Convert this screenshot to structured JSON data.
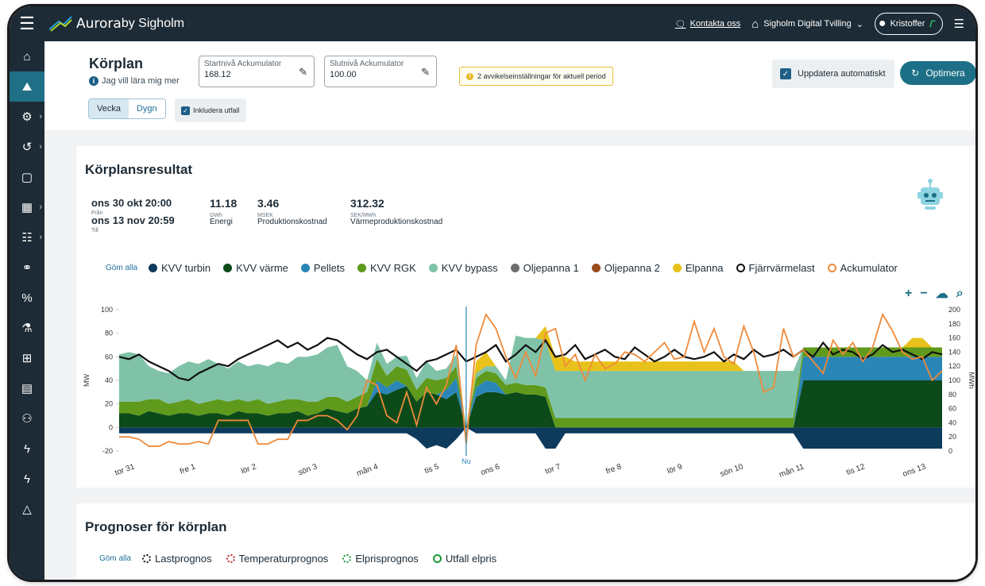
{
  "topbar": {
    "brand": "Aurora",
    "brand_by": "by Sigholm",
    "contact": "Kontakta oss",
    "plant": "Sigholm Digital Tvilling",
    "user": "Kristoffer"
  },
  "sidebar": {
    "items": [
      {
        "icon": "home-icon",
        "glyph": "⌂",
        "chevron": false,
        "active": false
      },
      {
        "icon": "chart-icon",
        "glyph": "⛰",
        "chevron": false,
        "active": true
      },
      {
        "icon": "gears-icon",
        "glyph": "⚙",
        "chevron": true,
        "active": false
      },
      {
        "icon": "history-icon",
        "glyph": "↺",
        "chevron": true,
        "active": false
      },
      {
        "icon": "note-icon",
        "glyph": "▢",
        "chevron": false,
        "active": false
      },
      {
        "icon": "calendar-icon",
        "glyph": "▦",
        "chevron": true,
        "active": false
      },
      {
        "icon": "contact-card-icon",
        "glyph": "☷",
        "chevron": true,
        "active": false
      },
      {
        "icon": "handshake-icon",
        "glyph": "⚭",
        "chevron": false,
        "active": false
      },
      {
        "icon": "percent-icon",
        "glyph": "%",
        "chevron": false,
        "active": false
      },
      {
        "icon": "flask-icon",
        "glyph": "⚗",
        "chevron": false,
        "active": false
      },
      {
        "icon": "grid-icon",
        "glyph": "⊞",
        "chevron": false,
        "active": false
      },
      {
        "icon": "document-icon",
        "glyph": "▤",
        "chevron": false,
        "active": false
      },
      {
        "icon": "users-icon",
        "glyph": "⚇",
        "chevron": false,
        "active": false
      },
      {
        "icon": "bolt-icon",
        "glyph": "ϟ",
        "chevron": false,
        "active": false
      },
      {
        "icon": "bolt-icon-2",
        "glyph": "ϟ",
        "chevron": false,
        "active": false
      },
      {
        "icon": "mountain-icon",
        "glyph": "△",
        "chevron": false,
        "active": false
      }
    ]
  },
  "header": {
    "title": "Körplan",
    "learn": "Jag vill lära mig mer",
    "start_label": "Startnivå Ackumulator",
    "start_value": "168.12",
    "end_label": "Slutnivå Ackumulator",
    "end_value": "100.00",
    "warning": "2 avvikelseinställningar för aktuell period",
    "auto_update": "Uppdatera automatiskt",
    "optimize": "Optimera",
    "seg_week": "Vecka",
    "seg_day": "Dygn",
    "include": "Inkludera utfall"
  },
  "result": {
    "title": "Körplansresultat",
    "from_date": "ons 30 okt 20:00",
    "from_label": "Från",
    "to_date": "ons 13 nov 20:59",
    "to_label": "Till",
    "metrics": [
      {
        "value": "11.18",
        "unit": "GWh",
        "label": "Energi"
      },
      {
        "value": "3.46",
        "unit": "MSEK",
        "label": "Produktionskostnad"
      },
      {
        "value": "312.32",
        "unit": "SEK/MWh",
        "label": "Värmeproduktionskostnad"
      }
    ],
    "hide_all": "Göm alla",
    "legend": [
      {
        "name": "KVV turbin",
        "color": "#0e3a5c",
        "style": "dot"
      },
      {
        "name": "KVV värme",
        "color": "#0c4a1a",
        "style": "dot"
      },
      {
        "name": "Pellets",
        "color": "#2b86b8",
        "style": "dot"
      },
      {
        "name": "KVV RGK",
        "color": "#5f9a1c",
        "style": "dot"
      },
      {
        "name": "KVV bypass",
        "color": "#7fc2a8",
        "style": "dot"
      },
      {
        "name": "Oljepanna 1",
        "color": "#6e6e6e",
        "style": "dot"
      },
      {
        "name": "Oljepanna 2",
        "color": "#9a4a1a",
        "style": "dot"
      },
      {
        "name": "Elpanna",
        "color": "#e8c21a",
        "style": "dot"
      },
      {
        "name": "Fjärrvärmelast",
        "color": "#111111",
        "style": "ring"
      },
      {
        "name": "Ackumulator",
        "color": "#ef8a3a",
        "style": "ring"
      }
    ]
  },
  "chart_data": {
    "type": "area",
    "ylabel": "MW",
    "y2label": "MWh",
    "ylim": [
      -20,
      100
    ],
    "y2lim": [
      0,
      200
    ],
    "yticks": [
      "100",
      "80",
      "60",
      "40",
      "20",
      "0",
      "-20"
    ],
    "y2ticks": [
      "200",
      "180",
      "160",
      "140",
      "120",
      "100",
      "80",
      "60",
      "40",
      "20",
      "0"
    ],
    "now_label": "Nu",
    "now_index": 35,
    "categories": [
      "tor 31",
      "fre 1",
      "lör 2",
      "sön 3",
      "mån 4",
      "tis 5",
      "ons 6",
      "tor 7",
      "fre 8",
      "lör 9",
      "sön 10",
      "mån 11",
      "tis 12",
      "ons 13"
    ],
    "x": [
      0,
      1,
      2,
      3,
      4,
      5,
      6,
      7,
      8,
      9,
      10,
      11,
      12,
      13,
      14,
      15,
      16,
      17,
      18,
      19,
      20,
      21,
      22,
      23,
      24,
      25,
      26,
      27,
      28,
      29,
      30,
      31,
      32,
      33,
      34,
      35,
      36,
      37,
      38,
      39,
      40,
      41,
      42,
      43,
      44,
      45,
      46,
      47,
      48,
      49,
      50,
      51,
      52,
      53,
      54,
      55,
      56,
      57,
      58,
      59,
      60,
      61,
      62,
      63,
      64,
      65,
      66,
      67,
      68,
      69,
      70,
      71,
      72,
      73,
      74,
      75,
      76,
      77,
      78,
      79,
      80,
      81,
      82,
      83
    ],
    "series": [
      {
        "name": "KVV turbin",
        "values": [
          -5,
          -5,
          -5,
          -5,
          -5,
          -5,
          -5,
          -5,
          -5,
          -5,
          -5,
          -5,
          -5,
          -5,
          -5,
          -5,
          -5,
          -5,
          -5,
          -5,
          -5,
          -5,
          -5,
          -5,
          -5,
          -5,
          -5,
          -5,
          -5,
          -5,
          -10,
          -18,
          -15,
          -18,
          -10,
          0,
          -5,
          -5,
          -5,
          -5,
          -5,
          -5,
          -5,
          -18,
          -18,
          -5,
          -5,
          -5,
          -5,
          -5,
          -5,
          -5,
          -5,
          -5,
          -5,
          -5,
          -5,
          -5,
          -5,
          -5,
          -5,
          -5,
          -5,
          -5,
          -5,
          -5,
          -5,
          -5,
          -5,
          -18,
          -18,
          -18,
          -18,
          -18,
          -18,
          -18,
          -18,
          -18,
          -18,
          -18,
          -18,
          -18,
          -18,
          -18
        ]
      },
      {
        "name": "KVV värme",
        "values": [
          12,
          12,
          10,
          14,
          12,
          10,
          12,
          12,
          10,
          12,
          12,
          10,
          14,
          12,
          12,
          10,
          12,
          12,
          14,
          10,
          12,
          16,
          14,
          12,
          16,
          18,
          30,
          28,
          32,
          35,
          22,
          30,
          28,
          24,
          30,
          0,
          26,
          30,
          30,
          28,
          30,
          28,
          28,
          26,
          0,
          0,
          0,
          0,
          0,
          0,
          0,
          0,
          0,
          0,
          0,
          0,
          0,
          0,
          0,
          0,
          0,
          0,
          0,
          0,
          0,
          0,
          0,
          0,
          0,
          40,
          40,
          40,
          40,
          40,
          40,
          40,
          40,
          40,
          40,
          40,
          40,
          40,
          40,
          40
        ]
      },
      {
        "name": "Pellets",
        "values": [
          0,
          0,
          0,
          0,
          0,
          0,
          0,
          0,
          0,
          0,
          0,
          0,
          0,
          0,
          0,
          0,
          0,
          0,
          0,
          0,
          0,
          0,
          0,
          0,
          0,
          0,
          10,
          6,
          8,
          0,
          0,
          0,
          0,
          8,
          12,
          0,
          8,
          10,
          8,
          0,
          0,
          0,
          0,
          0,
          0,
          0,
          0,
          0,
          0,
          0,
          0,
          0,
          0,
          0,
          0,
          0,
          0,
          0,
          0,
          0,
          0,
          0,
          0,
          0,
          0,
          0,
          0,
          0,
          0,
          20,
          20,
          20,
          20,
          20,
          20,
          20,
          20,
          20,
          20,
          20,
          20,
          20,
          20,
          20
        ]
      },
      {
        "name": "KVV RGK",
        "values": [
          10,
          10,
          12,
          10,
          12,
          10,
          10,
          12,
          10,
          10,
          12,
          12,
          10,
          10,
          12,
          10,
          10,
          12,
          10,
          12,
          10,
          10,
          12,
          10,
          10,
          12,
          18,
          10,
          12,
          14,
          10,
          12,
          12,
          10,
          10,
          0,
          8,
          8,
          8,
          8,
          8,
          8,
          8,
          8,
          8,
          8,
          8,
          8,
          8,
          8,
          8,
          8,
          8,
          8,
          8,
          8,
          8,
          8,
          8,
          8,
          8,
          8,
          8,
          8,
          8,
          8,
          8,
          8,
          8,
          8,
          8,
          8,
          8,
          8,
          8,
          8,
          8,
          8,
          8,
          8,
          8,
          8,
          8,
          8
        ]
      },
      {
        "name": "KVV bypass",
        "values": [
          40,
          42,
          40,
          28,
          24,
          26,
          30,
          32,
          34,
          36,
          30,
          28,
          32,
          30,
          30,
          32,
          34,
          30,
          36,
          38,
          40,
          42,
          44,
          30,
          22,
          10,
          14,
          10,
          8,
          12,
          10,
          14,
          8,
          8,
          10,
          0,
          4,
          4,
          6,
          4,
          40,
          40,
          40,
          40,
          40,
          40,
          40,
          40,
          40,
          40,
          40,
          40,
          40,
          40,
          40,
          40,
          40,
          40,
          40,
          40,
          40,
          40,
          40,
          40,
          40,
          40,
          40,
          40,
          40,
          0,
          0,
          0,
          0,
          0,
          0,
          0,
          0,
          0,
          0,
          0,
          0,
          0,
          0,
          0
        ]
      },
      {
        "name": "Elpanna",
        "values": [
          0,
          0,
          0,
          0,
          0,
          0,
          0,
          0,
          0,
          0,
          0,
          0,
          0,
          0,
          0,
          0,
          0,
          0,
          0,
          0,
          0,
          0,
          0,
          0,
          0,
          0,
          0,
          0,
          0,
          0,
          0,
          0,
          0,
          0,
          0,
          0,
          10,
          12,
          0,
          0,
          0,
          0,
          0,
          12,
          12,
          12,
          8,
          8,
          8,
          8,
          8,
          8,
          8,
          8,
          8,
          8,
          8,
          8,
          8,
          8,
          8,
          8,
          8,
          0,
          0,
          0,
          0,
          0,
          0,
          0,
          0,
          0,
          0,
          0,
          0,
          0,
          0,
          0,
          0,
          0,
          8,
          8,
          0,
          0
        ]
      },
      {
        "name": "Fjärrvärmelast",
        "values": [
          60,
          58,
          62,
          56,
          52,
          48,
          42,
          40,
          46,
          50,
          54,
          52,
          58,
          62,
          66,
          70,
          74,
          68,
          72,
          66,
          70,
          76,
          74,
          68,
          62,
          58,
          64,
          66,
          60,
          54,
          48,
          56,
          58,
          62,
          66,
          56,
          60,
          64,
          70,
          56,
          62,
          70,
          64,
          74,
          60,
          62,
          70,
          58,
          62,
          66,
          60,
          58,
          68,
          62,
          56,
          60,
          66,
          60,
          58,
          60,
          64,
          56,
          62,
          58,
          66,
          60,
          62,
          66,
          60,
          66,
          60,
          72,
          62,
          66,
          64,
          58,
          62,
          70,
          64,
          66,
          62,
          58,
          64,
          62
        ]
      },
      {
        "name": "Ackumulator",
        "values": [
          -8,
          -8,
          -10,
          -16,
          -16,
          -12,
          -14,
          -14,
          -12,
          -14,
          6,
          6,
          6,
          6,
          -14,
          -14,
          -10,
          -10,
          6,
          6,
          10,
          10,
          6,
          -2,
          10,
          40,
          36,
          10,
          4,
          30,
          2,
          34,
          20,
          36,
          70,
          -14,
          70,
          96,
          84,
          60,
          42,
          64,
          44,
          80,
          84,
          52,
          62,
          40,
          62,
          50,
          54,
          64,
          62,
          56,
          64,
          72,
          58,
          60,
          90,
          64,
          84,
          60,
          54,
          86,
          64,
          30,
          34,
          84,
          60,
          66,
          56,
          46,
          74,
          62,
          72,
          56,
          68,
          96,
          82,
          64,
          58,
          60,
          40,
          48
        ]
      }
    ]
  },
  "forecast": {
    "title": "Prognoser för körplan",
    "hide_all": "Göm alla",
    "legend": [
      {
        "name": "Lastprognos",
        "color": "#111111",
        "style": "dotted"
      },
      {
        "name": "Temperaturprognos",
        "color": "#c0282a",
        "style": "dotted"
      },
      {
        "name": "Elprisprognos",
        "color": "#1a9a3a",
        "style": "dotted"
      },
      {
        "name": "Utfall elpris",
        "color": "#1a9a3a",
        "style": "ring"
      }
    ]
  }
}
